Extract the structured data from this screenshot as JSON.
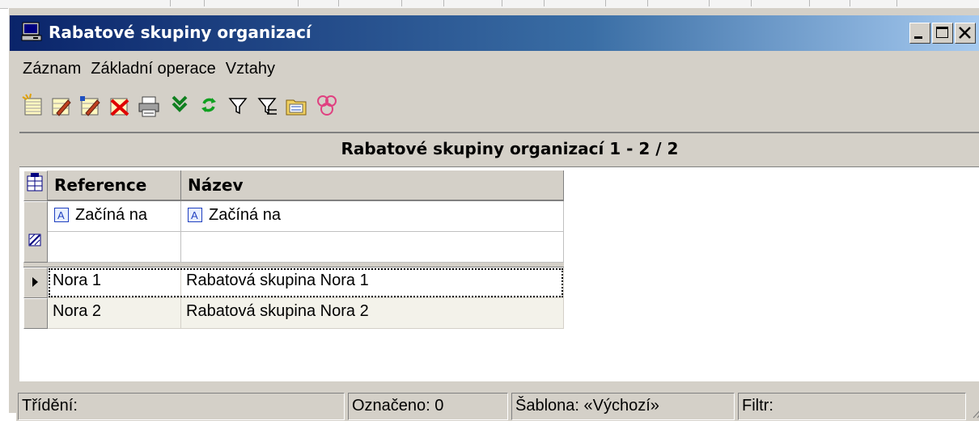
{
  "window": {
    "title": "Rabatové skupiny organizací",
    "icon": "monitor-icon",
    "controls": [
      "minimize-icon",
      "maximize-icon",
      "close-icon"
    ]
  },
  "menu": [
    "Záznam",
    "Základní operace",
    "Vztahy"
  ],
  "toolbar": [
    "new-record-icon",
    "edit-record-icon",
    "edit-copy-icon",
    "delete-record-icon",
    "print-icon",
    "import-arrow-icon",
    "refresh-icon",
    "filter-icon",
    "filter-clear-icon",
    "folder-icon",
    "links-icon"
  ],
  "grid": {
    "title": "Rabatové skupiny organizací  1 - 2 / 2",
    "columns": [
      "Reference",
      "Název"
    ],
    "filter_row": [
      "Začíná na",
      "Začíná na"
    ],
    "rows": [
      [
        "Nora 1",
        "Rabatová skupina Nora 1"
      ],
      [
        "Nora 2",
        "Rabatová skupina Nora 2"
      ]
    ],
    "selected_row": 1
  },
  "status": {
    "sort": "Třídění:",
    "marked": "Označeno: 0",
    "template": "Šablona: «Výchozí»",
    "filter": "Filtr:"
  },
  "colors": {
    "title_start": "#0a246a",
    "title_end": "#a6caf0",
    "chrome": "#d4d0c8",
    "alt_row": "#f3f2ea"
  }
}
